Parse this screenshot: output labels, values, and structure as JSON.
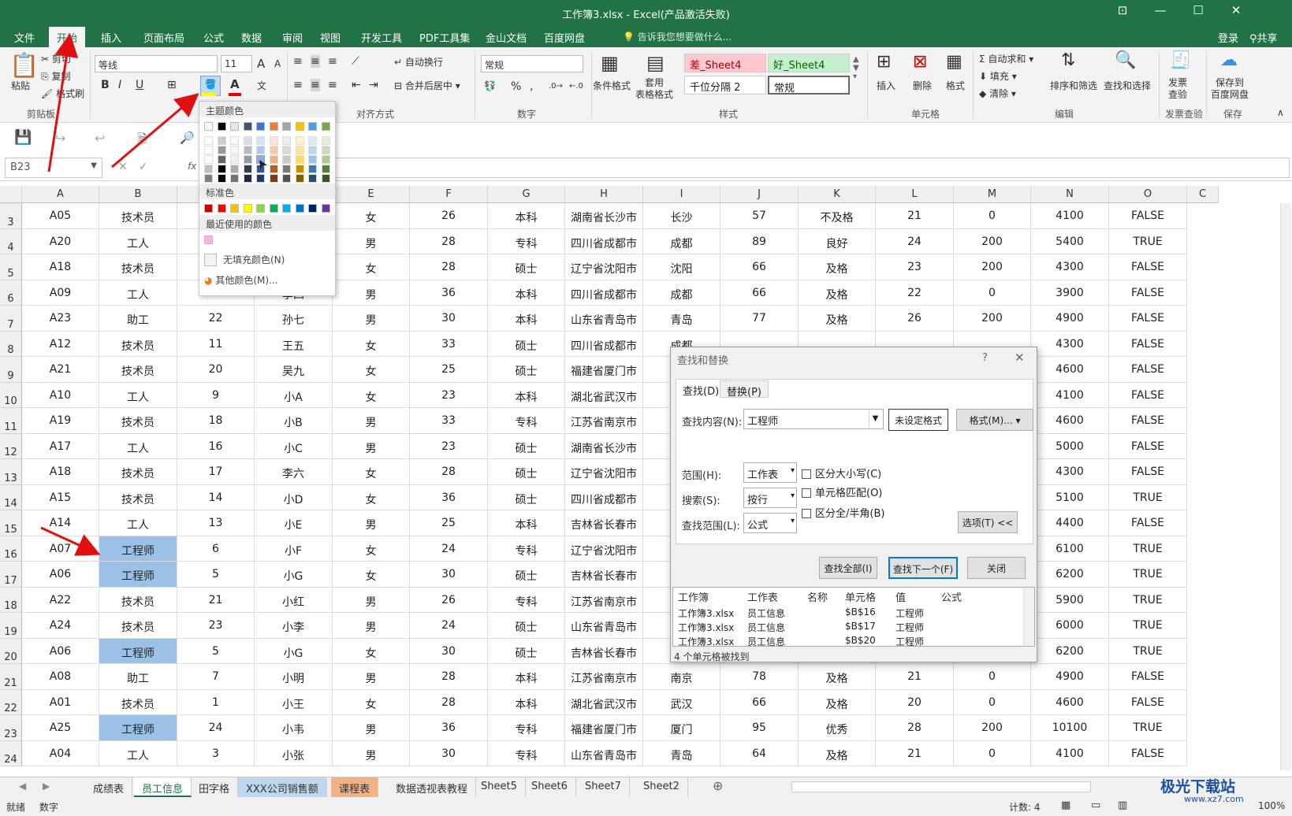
{
  "window": {
    "title": "工作簿3.xlsx - Excel(产品激活失败)"
  },
  "menu": {
    "tabs": [
      "文件",
      "开始",
      "插入",
      "页面布局",
      "公式",
      "数据",
      "审阅",
      "视图",
      "开发工具",
      "PDF工具集",
      "金山文档",
      "百度网盘"
    ],
    "active": "开始",
    "tell_me": "告诉我您想要做什么...",
    "login": "登录",
    "share": "共享"
  },
  "ribbon": {
    "clipboard": {
      "paste": "粘贴",
      "cut": "剪切",
      "copy": "复制",
      "format_painter": "格式刷",
      "label": "剪贴板"
    },
    "font": {
      "name": "等线",
      "size": "11",
      "label": "字体",
      "bold": "B",
      "italic": "I",
      "underline": "U",
      "grow": "A",
      "shrink": "A"
    },
    "alignment": {
      "wrap": "自动换行",
      "merge": "合并后居中",
      "label": "对齐方式"
    },
    "number": {
      "format": "常规",
      "label": "数字",
      "percent": "%",
      "comma": ","
    },
    "styles": {
      "cond": "条件格式",
      "table": "套用\n表格格式",
      "bad": "差_Sheet4",
      "good": "好_Sheet4",
      "thousands": "千位分隔 2",
      "normal": "常规",
      "label": "样式"
    },
    "cells": {
      "insert": "插入",
      "delete": "删除",
      "format": "格式",
      "label": "单元格"
    },
    "editing": {
      "autosum": "自动求和",
      "fill": "填充",
      "clear": "清除",
      "sort": "排序和筛选",
      "find": "查找和选择",
      "label": "编辑"
    },
    "invoice": {
      "btn": "发票\n查验",
      "label": "发票查验"
    },
    "save": {
      "btn": "保存到\n百度网盘",
      "label": "保存"
    }
  },
  "formula_bar": {
    "name_box": "B23",
    "fx": "fx"
  },
  "columns": [
    "A",
    "B",
    "C",
    "D",
    "E",
    "F",
    "G",
    "H",
    "I",
    "J",
    "K",
    "L",
    "M",
    "N",
    "O",
    "C"
  ],
  "rows": [
    {
      "n": "3",
      "v": [
        "A05",
        "技术员",
        "",
        "",
        "女",
        "26",
        "本科",
        "湖南省长沙市",
        "长沙",
        "57",
        "不及格",
        "21",
        "0",
        "4100",
        "FALSE"
      ]
    },
    {
      "n": "4",
      "v": [
        "A20",
        "工人",
        "",
        "",
        "男",
        "28",
        "专科",
        "四川省成都市",
        "成都",
        "89",
        "良好",
        "24",
        "200",
        "5400",
        "TRUE"
      ]
    },
    {
      "n": "5",
      "v": [
        "A18",
        "技术员",
        "",
        "",
        "女",
        "28",
        "硕士",
        "辽宁省沈阳市",
        "沈阳",
        "66",
        "及格",
        "23",
        "200",
        "4300",
        "FALSE"
      ]
    },
    {
      "n": "6",
      "v": [
        "A09",
        "工人",
        "8",
        "李四",
        "男",
        "36",
        "本科",
        "四川省成都市",
        "成都",
        "66",
        "及格",
        "22",
        "0",
        "3900",
        "FALSE"
      ]
    },
    {
      "n": "7",
      "v": [
        "A23",
        "助工",
        "22",
        "孙七",
        "男",
        "30",
        "本科",
        "山东省青岛市",
        "青岛",
        "77",
        "及格",
        "26",
        "200",
        "4900",
        "FALSE"
      ]
    },
    {
      "n": "8",
      "v": [
        "A12",
        "技术员",
        "11",
        "王五",
        "女",
        "33",
        "硕士",
        "四川省成都市",
        "成都",
        "",
        "",
        "",
        "",
        "4300",
        "FALSE"
      ]
    },
    {
      "n": "9",
      "v": [
        "A21",
        "技术员",
        "20",
        "吴九",
        "女",
        "25",
        "硕士",
        "福建省厦门市",
        "",
        "",
        "",
        "",
        "00",
        "4600",
        "FALSE"
      ]
    },
    {
      "n": "10",
      "v": [
        "A10",
        "工人",
        "9",
        "小A",
        "女",
        "23",
        "本科",
        "湖北省武汉市",
        "",
        "",
        "",
        "",
        "0",
        "4100",
        "FALSE"
      ]
    },
    {
      "n": "11",
      "v": [
        "A19",
        "技术员",
        "18",
        "小B",
        "男",
        "33",
        "专科",
        "江苏省南京市",
        "",
        "",
        "",
        "",
        "00",
        "4600",
        "FALSE"
      ]
    },
    {
      "n": "12",
      "v": [
        "A17",
        "工人",
        "16",
        "小C",
        "男",
        "23",
        "硕士",
        "湖南省长沙市",
        "",
        "",
        "",
        "",
        "00",
        "5000",
        "FALSE"
      ]
    },
    {
      "n": "13",
      "v": [
        "A18",
        "技术员",
        "17",
        "李六",
        "女",
        "28",
        "硕士",
        "辽宁省沈阳市",
        "",
        "",
        "",
        "",
        "00",
        "4300",
        "FALSE"
      ]
    },
    {
      "n": "14",
      "v": [
        "A15",
        "技术员",
        "14",
        "小D",
        "女",
        "36",
        "硕士",
        "四川省成都市",
        "",
        "",
        "",
        "",
        "00",
        "5100",
        "TRUE"
      ]
    },
    {
      "n": "15",
      "v": [
        "A14",
        "工人",
        "13",
        "小E",
        "男",
        "25",
        "本科",
        "吉林省长春市",
        "",
        "",
        "",
        "",
        "0",
        "4400",
        "FALSE"
      ]
    },
    {
      "n": "16",
      "v": [
        "A07",
        "工程师",
        "6",
        "小F",
        "女",
        "24",
        "专科",
        "辽宁省沈阳市",
        "",
        "",
        "",
        "",
        "00",
        "6100",
        "TRUE"
      ]
    },
    {
      "n": "17",
      "v": [
        "A06",
        "工程师",
        "5",
        "小G",
        "女",
        "30",
        "硕士",
        "吉林省长春市",
        "",
        "",
        "",
        "",
        "00",
        "6200",
        "TRUE"
      ]
    },
    {
      "n": "18",
      "v": [
        "A22",
        "技术员",
        "21",
        "小红",
        "男",
        "26",
        "专科",
        "江苏省南京市",
        "",
        "",
        "",
        "",
        "00",
        "5900",
        "TRUE"
      ]
    },
    {
      "n": "19",
      "v": [
        "A24",
        "技术员",
        "23",
        "小李",
        "男",
        "24",
        "硕士",
        "山东省青岛市",
        "",
        "",
        "",
        "",
        "00",
        "6000",
        "TRUE"
      ]
    },
    {
      "n": "20",
      "v": [
        "A06",
        "工程师",
        "5",
        "小G",
        "女",
        "30",
        "硕士",
        "吉林省长春市",
        "长春",
        "91",
        "优秀",
        "21",
        "200",
        "6200",
        "TRUE"
      ]
    },
    {
      "n": "21",
      "v": [
        "A08",
        "助工",
        "7",
        "小明",
        "男",
        "28",
        "本科",
        "江苏省南京市",
        "南京",
        "78",
        "及格",
        "21",
        "0",
        "4900",
        "FALSE"
      ]
    },
    {
      "n": "22",
      "v": [
        "A01",
        "技术员",
        "1",
        "小王",
        "女",
        "28",
        "本科",
        "湖北省武汉市",
        "武汉",
        "66",
        "及格",
        "20",
        "0",
        "4600",
        "FALSE"
      ]
    },
    {
      "n": "23",
      "v": [
        "A25",
        "工程师",
        "24",
        "小韦",
        "男",
        "36",
        "专科",
        "福建省厦门市",
        "厦门",
        "95",
        "优秀",
        "28",
        "200",
        "10100",
        "TRUE"
      ]
    },
    {
      "n": "24",
      "v": [
        "A04",
        "工人",
        "3",
        "小张",
        "男",
        "30",
        "专科",
        "山东省青岛市",
        "青岛",
        "64",
        "及格",
        "21",
        "0",
        "4100",
        "FALSE"
      ]
    }
  ],
  "highlight_rows": [
    "16",
    "17",
    "20",
    "23"
  ],
  "color_popup": {
    "theme_label": "主题颜色",
    "standard_label": "标准色",
    "recent_label": "最近使用的颜色",
    "no_fill": "无填充颜色(N)",
    "more": "其他颜色(M)...",
    "theme_top": [
      "#ffffff",
      "#000000",
      "#e7e6e6",
      "#44546a",
      "#4472c4",
      "#ed7d31",
      "#a5a5a5",
      "#ffc000",
      "#5b9bd5",
      "#70ad47"
    ],
    "standard": [
      "#c00000",
      "#ff0000",
      "#ffc000",
      "#ffff00",
      "#92d050",
      "#00b050",
      "#00b0f0",
      "#0070c0",
      "#002060",
      "#7030a0"
    ],
    "recent": [
      "#f4b6e0"
    ]
  },
  "find_dialog": {
    "title": "查找和替换",
    "help": "?",
    "close_x": "✕",
    "tab_find": "查找(D)",
    "tab_replace": "替换(P)",
    "find_label": "查找内容(N):",
    "find_value": "工程师",
    "no_format": "未设定格式",
    "format_btn": "格式(M)...",
    "scope_label": "范围(H):",
    "scope": "工作表",
    "search_label": "搜索(S):",
    "search": "按行",
    "lookin_label": "查找范围(L):",
    "lookin": "公式",
    "match_case": "区分大小写(C)",
    "match_cell": "单元格匹配(O)",
    "match_width": "区分全/半角(B)",
    "options": "选项(T) <<",
    "find_all": "查找全部(I)",
    "find_next": "查找下一个(F)",
    "close": "关闭",
    "result_headers": [
      "工作簿",
      "工作表",
      "名称",
      "单元格",
      "值",
      "公式"
    ],
    "results": [
      [
        "工作簿3.xlsx",
        "员工信息",
        "",
        "$B$16",
        "工程师",
        ""
      ],
      [
        "工作簿3.xlsx",
        "员工信息",
        "",
        "$B$17",
        "工程师",
        ""
      ],
      [
        "工作簿3.xlsx",
        "员工信息",
        "",
        "$B$20",
        "工程师",
        ""
      ]
    ],
    "status": "4 个单元格被找到"
  },
  "sheets": [
    "成绩表",
    "员工信息",
    "田字格",
    "XXX公司销售额",
    "课程表",
    "数据透视表教程",
    "Sheet5",
    "Sheet6",
    "Sheet7",
    "Sheet2"
  ],
  "active_sheet": "员工信息",
  "status": {
    "ready": "就绪",
    "num": "数字",
    "count": "计数: 4",
    "zoom": "100%"
  },
  "watermark": "极光下载站",
  "watermark_url": "www.xz7.com"
}
